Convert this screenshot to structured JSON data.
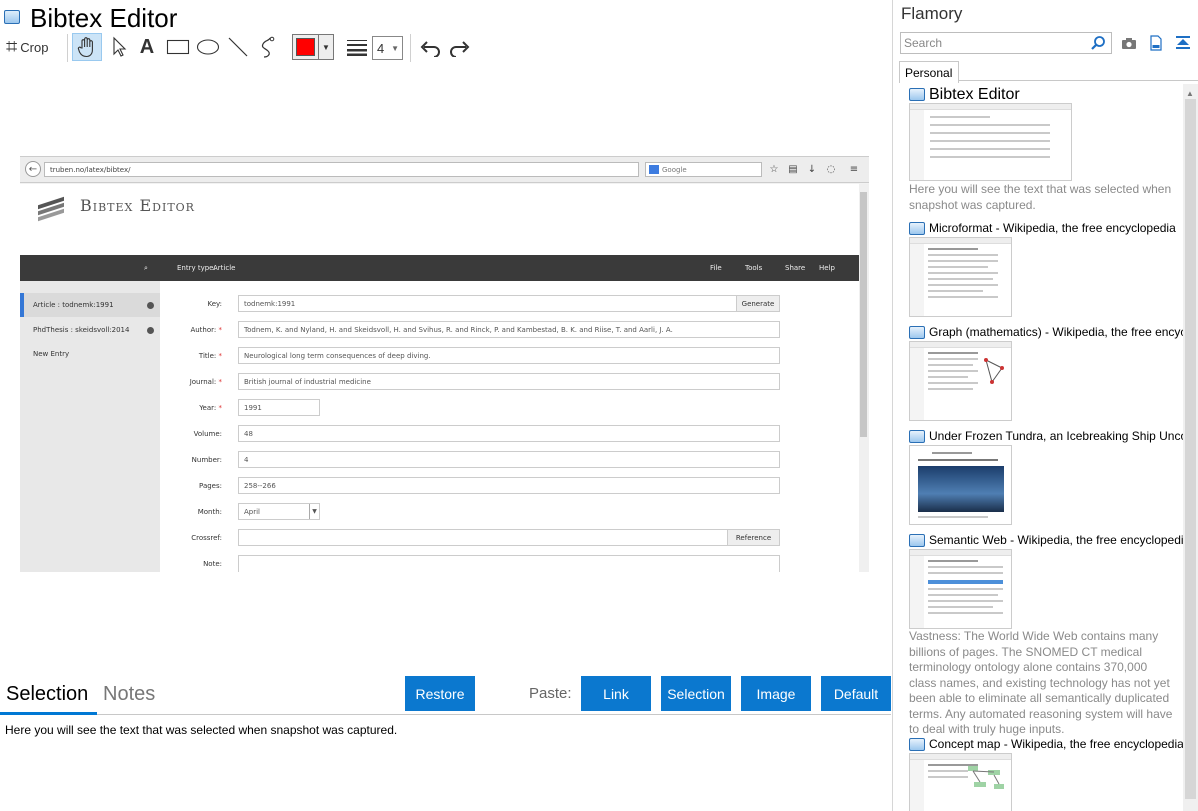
{
  "editor": {
    "title": "Bibtex Editor",
    "toolbar": {
      "crop_label": "Crop",
      "icons": [
        "crop-icon",
        "hand-icon",
        "pointer-icon",
        "text-icon",
        "rectangle-icon",
        "ellipse-icon",
        "line-icon",
        "freehand-icon",
        "color-picker",
        "line-width-icon",
        "undo-icon",
        "redo-icon"
      ],
      "color": "#ff0000",
      "line_width": "4"
    },
    "tabs": [
      {
        "label": "Selection",
        "active": true
      },
      {
        "label": "Notes",
        "active": false
      }
    ],
    "restore_label": "Restore",
    "paste_label": "Paste:",
    "paste_buttons": [
      "Link",
      "Selection",
      "Image",
      "Default"
    ],
    "selected_text": "Here you will see the text that was selected when snapshot was captured.",
    "accent": "#0b78cf"
  },
  "snapshot": {
    "url": "truben.no/latex/bibtex/",
    "search_placeholder": "Google",
    "app_name": "Bibtex Editor",
    "nav": {
      "entry_type_label": "Entry type:",
      "entry_type_value": "Article",
      "menus": [
        "File",
        "Tools",
        "Share",
        "Help"
      ]
    },
    "entries": [
      "Article : todnemk:1991",
      "PhdThesis : skeidsvoll:2014"
    ],
    "new_entry": "New Entry",
    "fields": [
      {
        "label": "Key:",
        "value": "todnemk:1991",
        "required": false
      },
      {
        "label": "Author:",
        "value": "Todnem, K. and Nyland, H. and Skeidsvoll, H. and Svihus, R. and Rinck, P. and Kambestad, B. K. and Riise, T. and Aarli, J. A.",
        "required": true
      },
      {
        "label": "Title:",
        "value": "Neurological long term consequences of deep diving.",
        "required": true
      },
      {
        "label": "Journal:",
        "value": "British journal of industrial medicine",
        "required": true
      },
      {
        "label": "Year:",
        "value": "1991",
        "required": true
      },
      {
        "label": "Volume:",
        "value": "48",
        "required": false
      },
      {
        "label": "Number:",
        "value": "4",
        "required": false
      },
      {
        "label": "Pages:",
        "value": "258--266",
        "required": false
      },
      {
        "label": "Month:",
        "value": "April",
        "required": false
      },
      {
        "label": "Crossref:",
        "value": "",
        "required": false
      },
      {
        "label": "Note:",
        "value": "",
        "required": false
      }
    ],
    "generate_label": "Generate",
    "reference_label": "Reference"
  },
  "flamory": {
    "title": "Flamory",
    "search_placeholder": "Search",
    "tab": "Personal",
    "items": [
      {
        "title": "Bibtex Editor",
        "desc": "Here you will see the text that was selected when snapshot was captured."
      },
      {
        "title": "Microformat - Wikipedia, the free encyclopedia",
        "desc": ""
      },
      {
        "title": "Graph (mathematics) - Wikipedia, the free encyclopedia",
        "desc": ""
      },
      {
        "title": "Under Frozen Tundra, an Icebreaking Ship Uncovers...",
        "desc": ""
      },
      {
        "title": "Semantic Web - Wikipedia, the free encyclopedia",
        "desc": "Vastness: The World Wide Web contains many billions of pages. The SNOMED CT medical terminology ontology alone contains 370,000 class names, and existing technology has not yet been able to eliminate all semantically duplicated terms. Any automated reasoning system will have to deal with truly huge inputs."
      },
      {
        "title": "Concept map - Wikipedia, the free encyclopedia",
        "desc": ""
      }
    ]
  }
}
